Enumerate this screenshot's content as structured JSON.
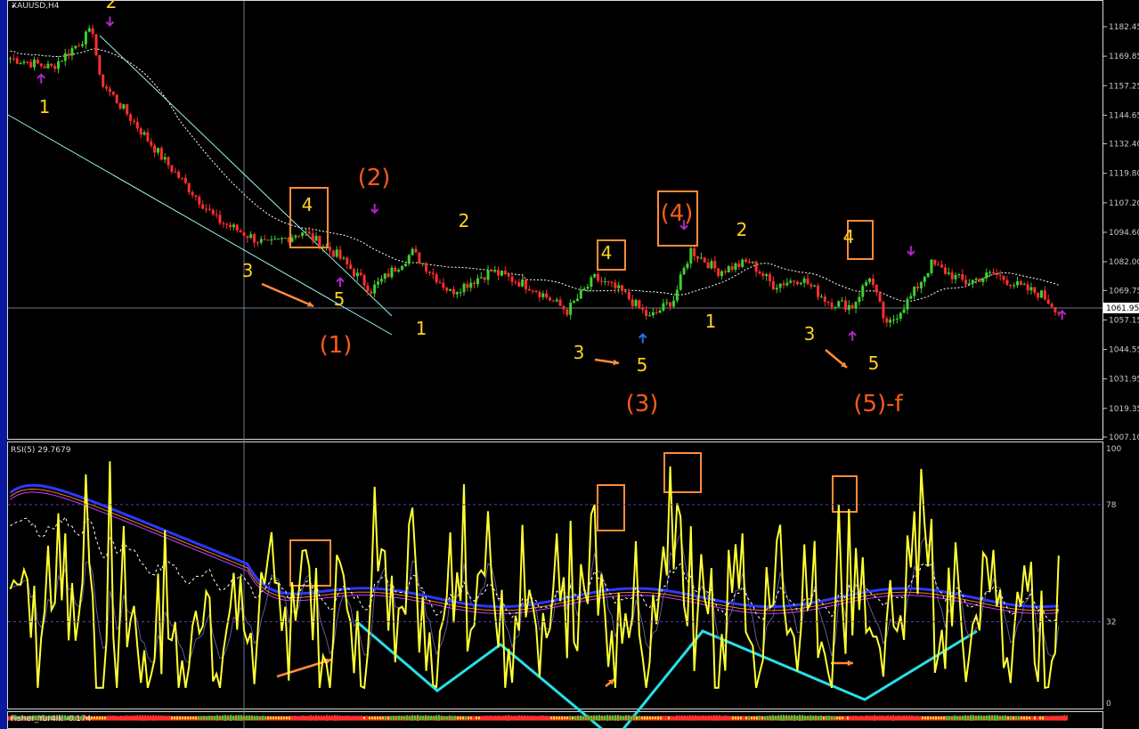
{
  "chart_title": "XAUUSD,H4",
  "rsi_label": "RSI(5) 29.7679",
  "fisher_label": "Fisher_Yur4ik -0.174",
  "current_price_label": "1061.95",
  "colors": {
    "background": "#000000",
    "bull": "#3fcf2f",
    "bear": "#ff2f2f",
    "rsi": "#ffff33",
    "ma": "#ffffff",
    "channel": "#9cf0e0",
    "cyan": "#27e0e8",
    "box": "#ff8c3a",
    "wave_small": "#ffd21f",
    "wave_big": "#ff5a1a",
    "arrow_mark": "#b026c8",
    "arrow_mark_blue": "#2a6cff"
  },
  "chart_data": [
    {
      "type": "candlestick",
      "title": "XAUUSD,H4",
      "ylim": [
        1007.1,
        1188.0
      ],
      "y_ticks": [
        "1182.45",
        "1169.85",
        "1157.25",
        "1144.65",
        "1132.40",
        "1119.80",
        "1107.20",
        "1094.60",
        "1082.00",
        "1069.75",
        "1057.15",
        "1044.55",
        "1031.95",
        "1019.35",
        "1007.10"
      ],
      "current_price": "1061.95",
      "key_prices": [
        {
          "bar": 0,
          "price": 1169.0
        },
        {
          "bar": 12,
          "price": 1165.0
        },
        {
          "bar": 24,
          "price": 1181.0
        },
        {
          "bar": 26,
          "price": 1160.0
        },
        {
          "bar": 45,
          "price": 1125.0
        },
        {
          "bar": 60,
          "price": 1100.0
        },
        {
          "bar": 75,
          "price": 1089.0
        },
        {
          "bar": 85,
          "price": 1095.0
        },
        {
          "bar": 95,
          "price": 1085.0
        },
        {
          "bar": 105,
          "price": 1070.0
        },
        {
          "bar": 117,
          "price": 1086.0
        },
        {
          "bar": 128,
          "price": 1069.0
        },
        {
          "bar": 140,
          "price": 1078.0
        },
        {
          "bar": 152,
          "price": 1071.0
        },
        {
          "bar": 162,
          "price": 1061.0
        },
        {
          "bar": 170,
          "price": 1075.0
        },
        {
          "bar": 178,
          "price": 1069.0
        },
        {
          "bar": 186,
          "price": 1058.0
        },
        {
          "bar": 193,
          "price": 1066.0
        },
        {
          "bar": 198,
          "price": 1087.0
        },
        {
          "bar": 206,
          "price": 1078.0
        },
        {
          "bar": 215,
          "price": 1082.0
        },
        {
          "bar": 222,
          "price": 1072.0
        },
        {
          "bar": 230,
          "price": 1075.0
        },
        {
          "bar": 238,
          "price": 1065.0
        },
        {
          "bar": 245,
          "price": 1063.0
        },
        {
          "bar": 250,
          "price": 1076.0
        },
        {
          "bar": 255,
          "price": 1054.0
        },
        {
          "bar": 262,
          "price": 1067.0
        },
        {
          "bar": 268,
          "price": 1081.0
        },
        {
          "bar": 278,
          "price": 1073.0
        },
        {
          "bar": 286,
          "price": 1077.0
        },
        {
          "bar": 294,
          "price": 1071.0
        },
        {
          "bar": 300,
          "price": 1068.0
        },
        {
          "bar": 305,
          "price": 1061.0
        }
      ]
    },
    {
      "type": "line",
      "title": "RSI(5) 29.7679",
      "ylim": [
        0,
        100
      ],
      "y_ticks": [
        "100",
        "78",
        "32",
        "0"
      ],
      "levels": [
        78,
        32
      ],
      "last_value": 29.7679
    }
  ],
  "wave_labels_small": [
    {
      "text": "2",
      "bar": 29,
      "price": 1188.5
    },
    {
      "text": "1",
      "bar": 9,
      "price": 1148.0
    },
    {
      "text": "4",
      "bar": 84,
      "price": 1102.5
    },
    {
      "text": "3",
      "bar": 68,
      "price": 1080.5
    },
    {
      "text": "5",
      "bar": 95,
      "price": 1065.0
    },
    {
      "text": "2",
      "bar": 132,
      "price": 1096.0
    },
    {
      "text": "1",
      "bar": 118,
      "price": 1055.5
    },
    {
      "text": "4",
      "bar": 170,
      "price": 1084.5
    },
    {
      "text": "3",
      "bar": 163,
      "price": 1046.0
    },
    {
      "text": "5",
      "bar": 182,
      "price": 1041.0
    },
    {
      "text": "2",
      "bar": 211,
      "price": 1096.0
    },
    {
      "text": "1",
      "bar": 201,
      "price": 1058.5
    },
    {
      "text": "4",
      "bar": 241,
      "price": 1091.5
    },
    {
      "text": "3",
      "bar": 229,
      "price": 1053.5
    },
    {
      "text": "5",
      "bar": 248,
      "price": 1041.0
    }
  ],
  "wave_labels_big": [
    {
      "text": "(2)",
      "bar": 106,
      "price": 1115.5
    },
    {
      "text": "(1)",
      "bar": 94,
      "price": 1050.5
    },
    {
      "text": "(4)",
      "bar": 192,
      "price": 1101.5
    },
    {
      "text": "(3)",
      "bar": 181,
      "price": 1026.5
    },
    {
      "text": "(5)-f",
      "bar": 252,
      "price": 1026.5
    }
  ]
}
